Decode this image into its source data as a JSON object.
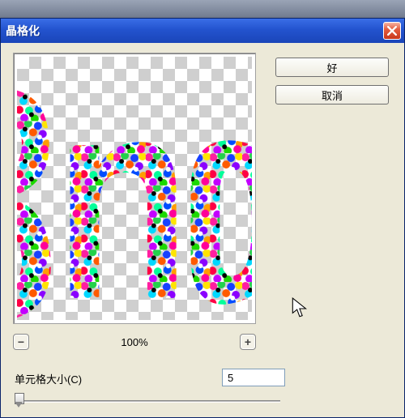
{
  "title": "晶格化",
  "buttons": {
    "ok": "好",
    "cancel": "取消"
  },
  "zoom": {
    "level": "100%",
    "minus": "−",
    "plus": "+"
  },
  "param": {
    "label": "单元格大小(C)",
    "value": "5"
  },
  "icons": {
    "close": "close-icon"
  },
  "text_preview": "Sno"
}
